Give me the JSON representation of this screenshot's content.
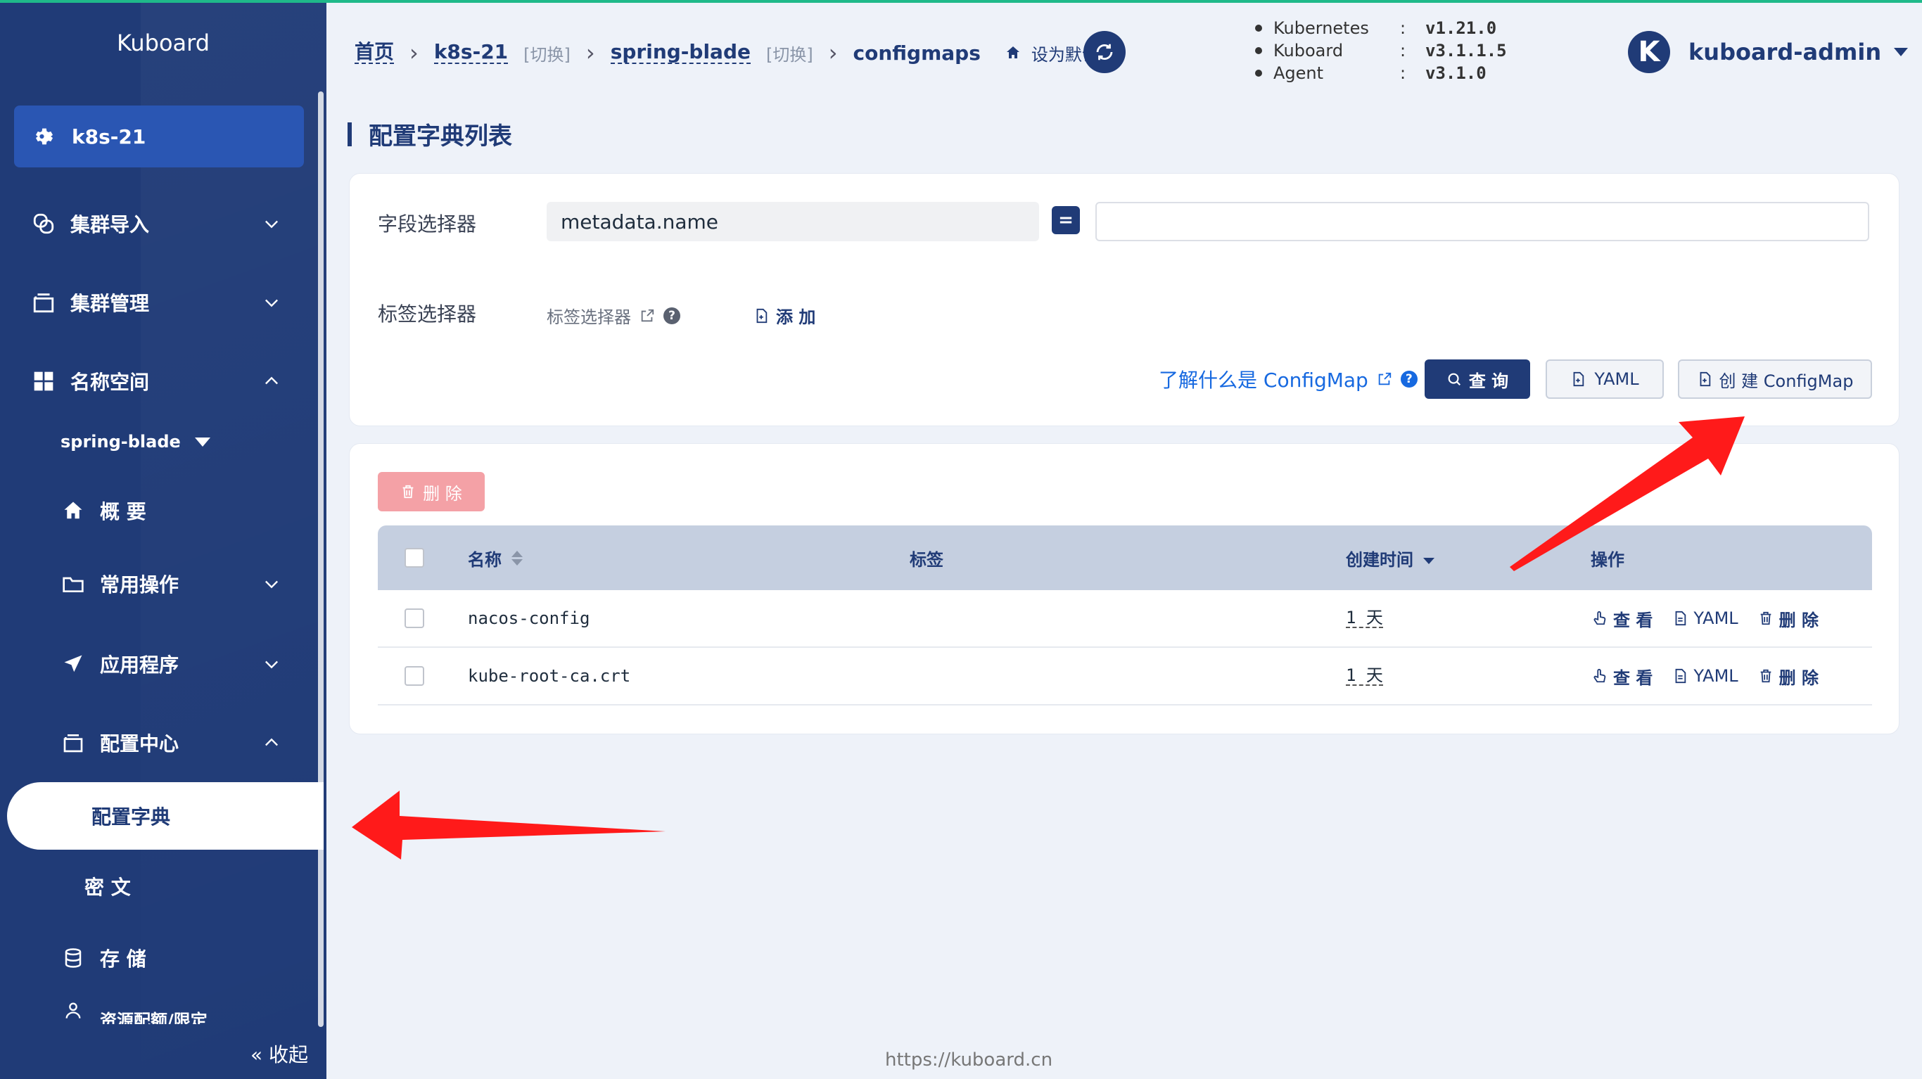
{
  "sidebar": {
    "brand": "Kuboard",
    "cluster": "k8s-21",
    "items": [
      {
        "label": "集群导入"
      },
      {
        "label": "集群管理"
      },
      {
        "label": "名称空间"
      },
      {
        "label": "概 要"
      },
      {
        "label": "常用操作"
      },
      {
        "label": "应用程序"
      },
      {
        "label": "配置中心"
      },
      {
        "label": "配置字典"
      },
      {
        "label": "密 文"
      },
      {
        "label": "存 储"
      },
      {
        "label": "资源配额/限定"
      }
    ],
    "namespace": "spring-blade",
    "collapse": "« 收起"
  },
  "breadcrumb": {
    "home": "首页",
    "cluster": "k8s-21",
    "switch": "[切换]",
    "namespace": "spring-blade",
    "current": "configmaps",
    "set_default": "设为默认页"
  },
  "versions": [
    {
      "name": "Kubernetes",
      "sep": ":",
      "value": "v1.21.0"
    },
    {
      "name": "Kuboard",
      "sep": ":",
      "value": "v3.1.1.5"
    },
    {
      "name": "Agent",
      "sep": ":",
      "value": "v3.1.0"
    }
  ],
  "user": {
    "initial": "K",
    "name": "kuboard-admin"
  },
  "page": {
    "title": "配置字典列表"
  },
  "filter": {
    "field_label": "字段选择器",
    "field_value": "metadata.name",
    "operator": "=",
    "field_input_value": "",
    "label_label": "标签选择器",
    "label_text": "标签选择器",
    "add": "添 加",
    "learn": "了解什么是 ConfigMap",
    "query": "查 询",
    "yaml": "YAML",
    "create": "创 建 ConfigMap"
  },
  "table": {
    "delete": "删 除",
    "headers": {
      "name": "名称",
      "labels": "标签",
      "created": "创建时间",
      "ops": "操作"
    },
    "rows": [
      {
        "name": "nacos-config",
        "age": "1 天",
        "view": "查 看",
        "yaml": "YAML",
        "delete": "删 除"
      },
      {
        "name": "kube-root-ca.crt",
        "age": "1 天",
        "view": "查 看",
        "yaml": "YAML",
        "delete": "删 除"
      }
    ]
  },
  "footer": "https://kuboard.cn",
  "colors": {
    "primary": "#203b77",
    "accent_green": "#1fb98a",
    "link": "#1769e0",
    "danger_light": "#f4a1a6",
    "arrow": "#ff1a1a"
  }
}
